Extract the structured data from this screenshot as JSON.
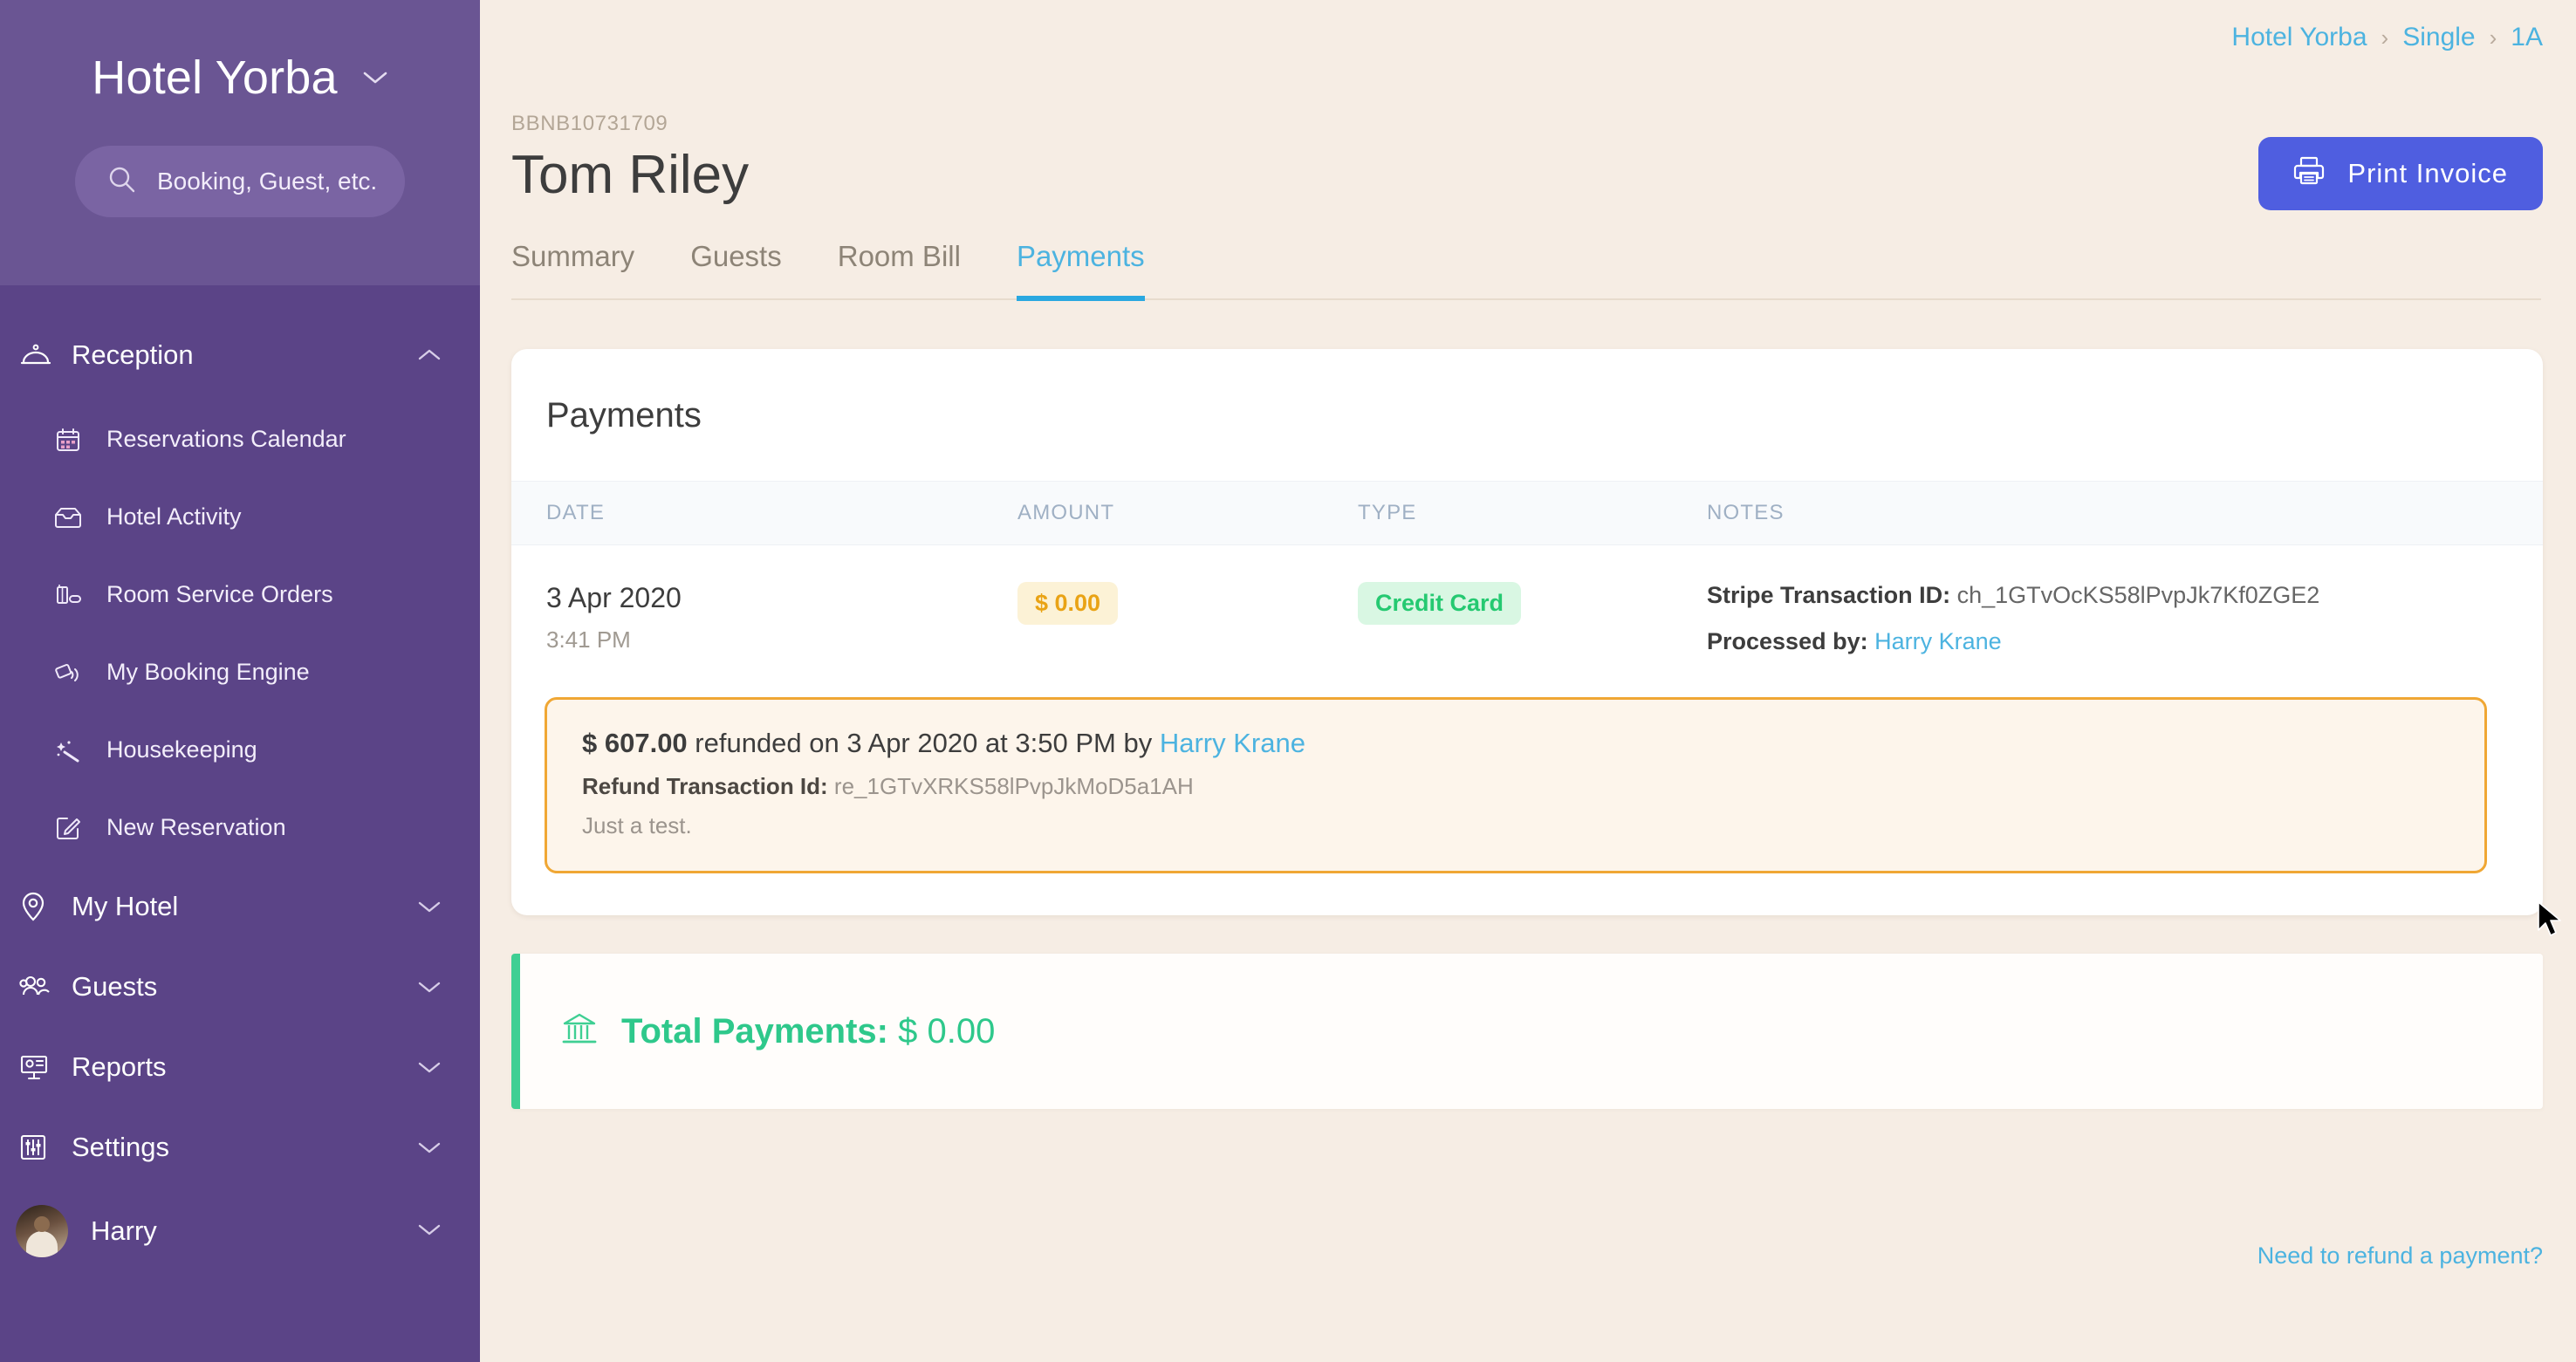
{
  "sidebar": {
    "brand": "Hotel Yorba",
    "brand_caret_icon": "chevron-down-icon",
    "search": {
      "placeholder": "Booking, Guest, etc.",
      "icon": "search-icon"
    },
    "groups": [
      {
        "label": "Reception",
        "icon": "room-service-bell-icon",
        "caret": "chevron-up-icon",
        "expanded": true,
        "items": [
          {
            "label": "Reservations Calendar",
            "icon": "calendar-icon"
          },
          {
            "label": "Hotel Activity",
            "icon": "inbox-icon"
          },
          {
            "label": "Room Service Orders",
            "icon": "drink-tray-icon"
          },
          {
            "label": "My Booking Engine",
            "icon": "booking-engine-icon"
          },
          {
            "label": "Housekeeping",
            "icon": "magic-wand-icon"
          },
          {
            "label": "New Reservation",
            "icon": "edit-square-icon"
          }
        ]
      },
      {
        "label": "My Hotel",
        "icon": "location-pin-icon",
        "caret": "chevron-down-icon",
        "expanded": false,
        "items": []
      },
      {
        "label": "Guests",
        "icon": "people-icon",
        "caret": "chevron-down-icon",
        "expanded": false,
        "items": []
      },
      {
        "label": "Reports",
        "icon": "presentation-chart-icon",
        "caret": "chevron-down-icon",
        "expanded": false,
        "items": []
      },
      {
        "label": "Settings",
        "icon": "sliders-icon",
        "caret": "chevron-down-icon",
        "expanded": false,
        "items": []
      }
    ],
    "user": {
      "name": "Harry",
      "avatar_icon": "avatar",
      "caret": "chevron-down-icon"
    }
  },
  "breadcrumb": {
    "items": [
      "Hotel Yorba",
      "Single",
      "1A"
    ],
    "separator": "›"
  },
  "header": {
    "booking_id": "BBNB10731709",
    "guest_name": "Tom Riley",
    "print_button": {
      "label": "Print Invoice",
      "icon": "printer-icon"
    }
  },
  "tabs": [
    {
      "label": "Summary",
      "active": false
    },
    {
      "label": "Guests",
      "active": false
    },
    {
      "label": "Room Bill",
      "active": false
    },
    {
      "label": "Payments",
      "active": true
    }
  ],
  "payments_card": {
    "title": "Payments",
    "columns": [
      "DATE",
      "AMOUNT",
      "TYPE",
      "NOTES"
    ],
    "row": {
      "date": "3 Apr 2020",
      "time": "3:41 PM",
      "amount": "$ 0.00",
      "type": "Credit Card",
      "notes": {
        "stripe_label": "Stripe Transaction ID:",
        "stripe_value": "ch_1GTvOcKS58lPvpJk7Kf0ZGE2",
        "processed_label": "Processed by:",
        "processed_value": "Harry Krane"
      }
    },
    "refund": {
      "amount": "$ 607.00",
      "text": " refunded on 3 Apr 2020 at 3:50 PM by ",
      "by": "Harry Krane",
      "txn_label": "Refund Transaction Id:",
      "txn_value": "re_1GTvXRKS58lPvpJkMoD5a1AH",
      "note": "Just a test."
    }
  },
  "total": {
    "icon": "bank-icon",
    "label": "Total Payments:",
    "amount": "$ 0.00"
  },
  "footer": {
    "refund_link": "Need to refund a payment?"
  },
  "colors": {
    "sidebar_bg": "#5b4487",
    "sidebar_top_bg": "#6a5593",
    "page_bg": "#f6ede4",
    "accent_blue": "#4cb3e0",
    "primary_button": "#4f5ee0",
    "amber": "#e9a315",
    "green": "#25c971",
    "refund_border": "#f0a734"
  }
}
